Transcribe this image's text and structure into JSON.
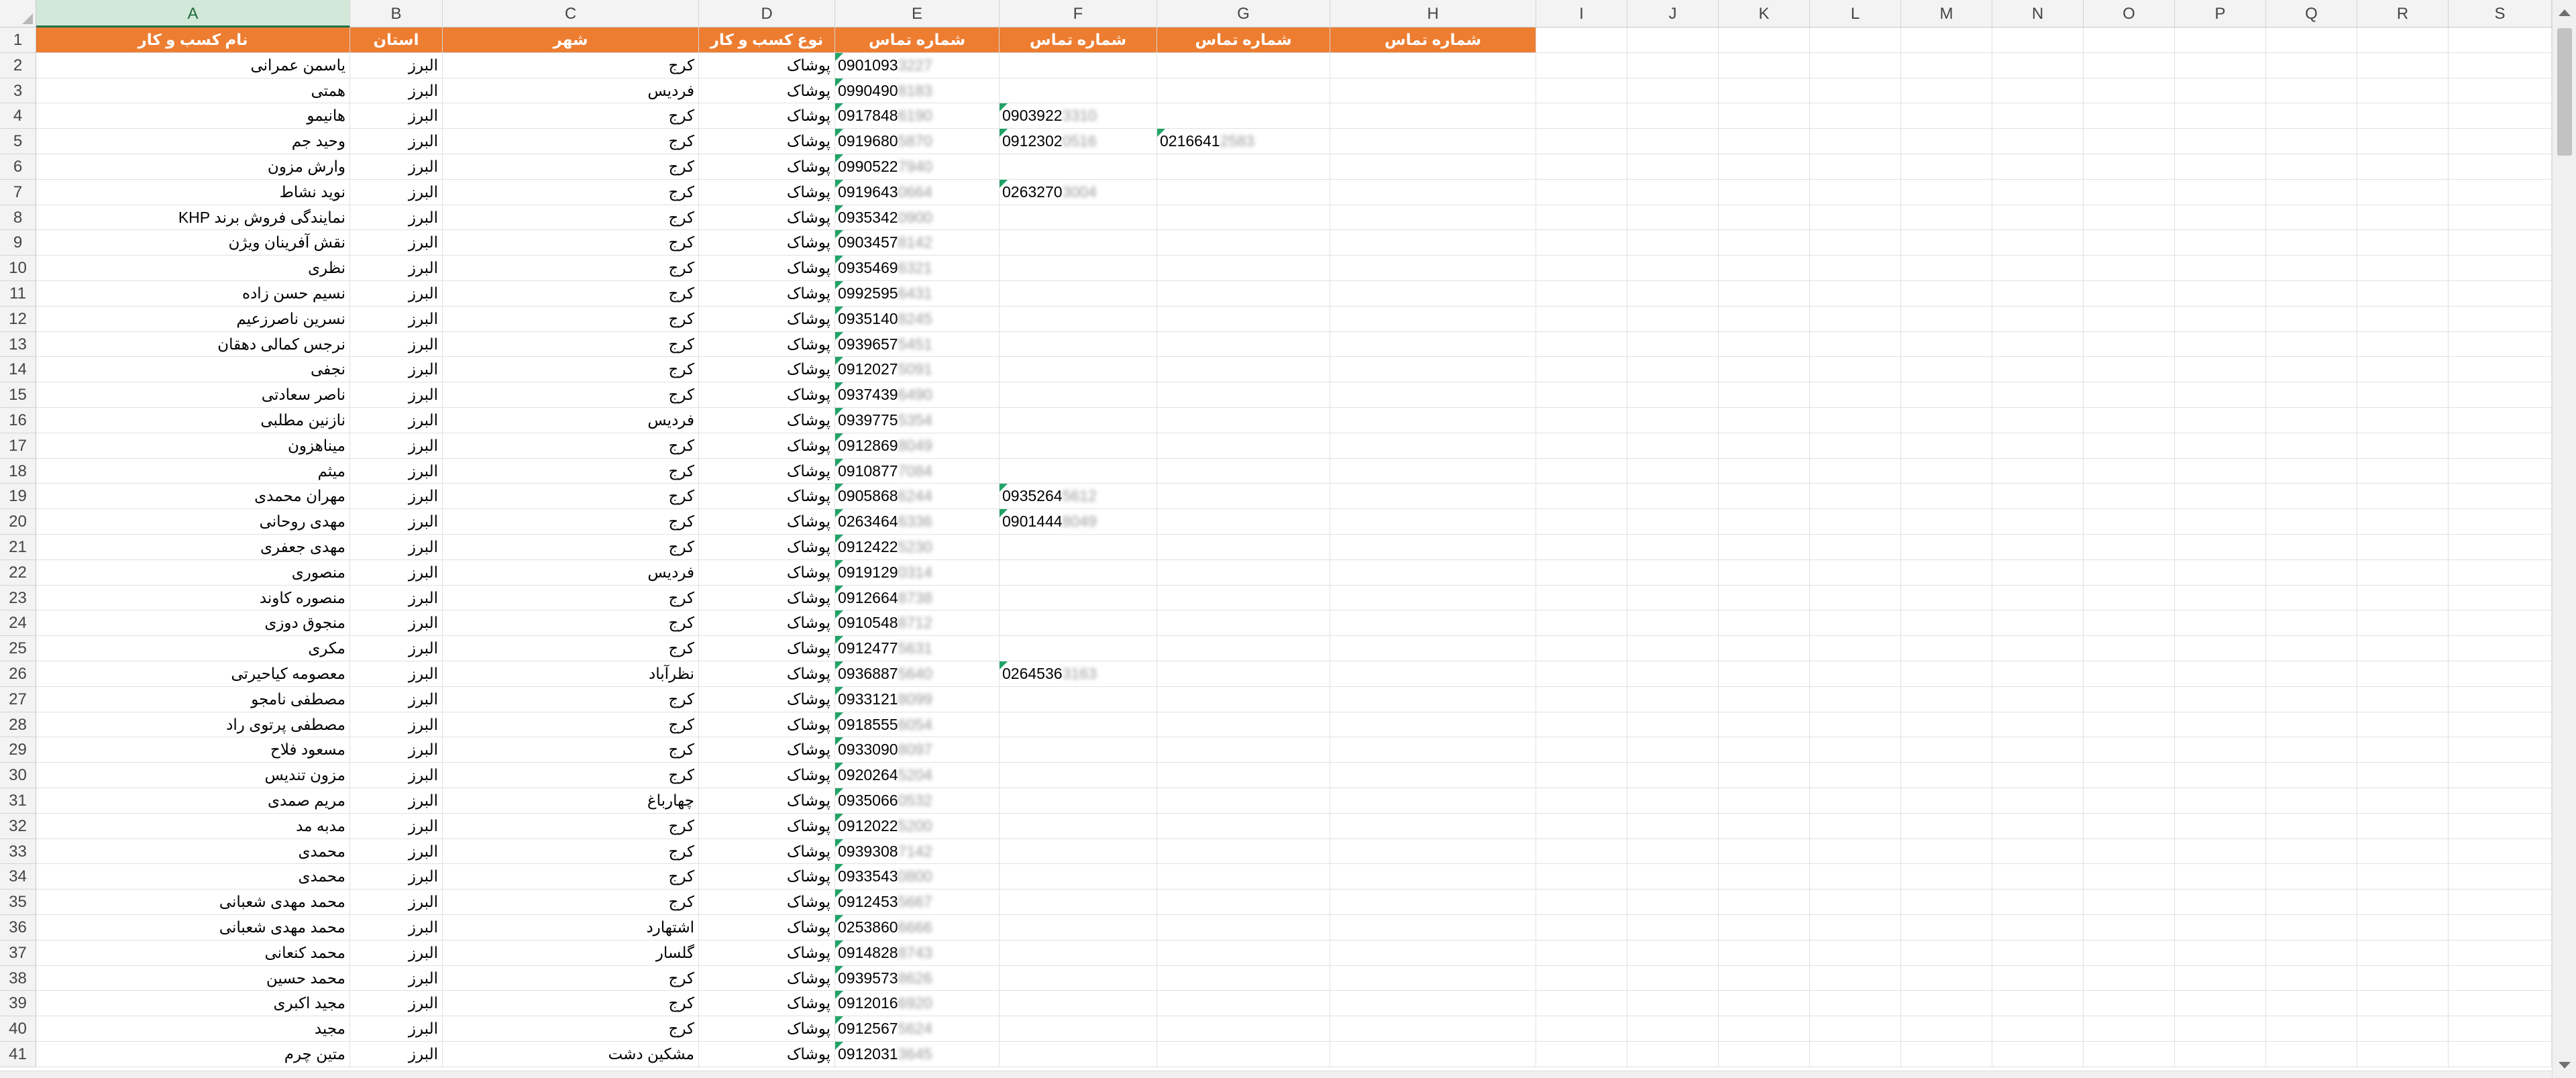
{
  "column_letters": [
    "A",
    "B",
    "C",
    "D",
    "E",
    "F",
    "G",
    "H",
    "I",
    "J",
    "K",
    "L",
    "M",
    "N",
    "O",
    "P",
    "Q",
    "R",
    "S"
  ],
  "selected_column": "A",
  "header_row": {
    "row_number": "1",
    "cells": [
      "نام کسب و کار",
      "استان",
      "شهر",
      "نوع کسب و کار",
      "شماره تماس",
      "شماره تماس",
      "شماره تماس",
      "شماره تماس"
    ]
  },
  "rows": [
    {
      "n": "2",
      "name": "یاسمن عمرانی",
      "prov": "البرز",
      "city": "کرج",
      "type": "پوشاک",
      "phones": [
        [
          "0901093",
          "3227"
        ]
      ]
    },
    {
      "n": "3",
      "name": "همتی",
      "prov": "البرز",
      "city": "فردیس",
      "type": "پوشاک",
      "phones": [
        [
          "0990490",
          "8183"
        ]
      ]
    },
    {
      "n": "4",
      "name": "هانیمو",
      "prov": "البرز",
      "city": "کرج",
      "type": "پوشاک",
      "phones": [
        [
          "0917848",
          "6190"
        ],
        [
          "0903922",
          "3310"
        ]
      ]
    },
    {
      "n": "5",
      "name": "وحید جم",
      "prov": "البرز",
      "city": "کرج",
      "type": "پوشاک",
      "phones": [
        [
          "0919680",
          "5870"
        ],
        [
          "0912302",
          "0516"
        ],
        [
          "0216641",
          "2583"
        ]
      ]
    },
    {
      "n": "6",
      "name": "وارش مزون",
      "prov": "البرز",
      "city": "کرج",
      "type": "پوشاک",
      "phones": [
        [
          "0990522",
          "7940"
        ]
      ]
    },
    {
      "n": "7",
      "name": "نوید نشاط",
      "prov": "البرز",
      "city": "کرج",
      "type": "پوشاک",
      "phones": [
        [
          "0919643",
          "0664"
        ],
        [
          "0263270",
          "3004"
        ]
      ]
    },
    {
      "n": "8",
      "name": "نمایندگی فروش برند KHP",
      "prov": "البرز",
      "city": "کرج",
      "type": "پوشاک",
      "phones": [
        [
          "0935342",
          "0900"
        ]
      ]
    },
    {
      "n": "9",
      "name": "نقش آفرینان ویژن",
      "prov": "البرز",
      "city": "کرج",
      "type": "پوشاک",
      "phones": [
        [
          "0903457",
          "8142"
        ]
      ]
    },
    {
      "n": "10",
      "name": "نظری",
      "prov": "البرز",
      "city": "کرج",
      "type": "پوشاک",
      "phones": [
        [
          "0935469",
          "6321"
        ]
      ]
    },
    {
      "n": "11",
      "name": "نسیم حسن زاده",
      "prov": "البرز",
      "city": "کرج",
      "type": "پوشاک",
      "phones": [
        [
          "0992595",
          "6431"
        ]
      ]
    },
    {
      "n": "12",
      "name": "نسرین ناصرزعیم",
      "prov": "البرز",
      "city": "کرج",
      "type": "پوشاک",
      "phones": [
        [
          "0935140",
          "8245"
        ]
      ]
    },
    {
      "n": "13",
      "name": "نرجس کمالی دهقان",
      "prov": "البرز",
      "city": "کرج",
      "type": "پوشاک",
      "phones": [
        [
          "0939657",
          "5451"
        ]
      ]
    },
    {
      "n": "14",
      "name": "نجفی",
      "prov": "البرز",
      "city": "کرج",
      "type": "پوشاک",
      "phones": [
        [
          "0912027",
          "5091"
        ]
      ]
    },
    {
      "n": "15",
      "name": "ناصر سعادتی",
      "prov": "البرز",
      "city": "کرج",
      "type": "پوشاک",
      "phones": [
        [
          "0937439",
          "6490"
        ]
      ]
    },
    {
      "n": "16",
      "name": "نازنین مطلبی",
      "prov": "البرز",
      "city": "فردیس",
      "type": "پوشاک",
      "phones": [
        [
          "0939775",
          "5354"
        ]
      ]
    },
    {
      "n": "17",
      "name": "میناهزون",
      "prov": "البرز",
      "city": "کرج",
      "type": "پوشاک",
      "phones": [
        [
          "0912869",
          "8049"
        ]
      ]
    },
    {
      "n": "18",
      "name": "میثم",
      "prov": "البرز",
      "city": "کرج",
      "type": "پوشاک",
      "phones": [
        [
          "0910877",
          "7084"
        ]
      ]
    },
    {
      "n": "19",
      "name": "مهران محمدی",
      "prov": "البرز",
      "city": "کرج",
      "type": "پوشاک",
      "phones": [
        [
          "0905868",
          "6244"
        ],
        [
          "0935264",
          "5612"
        ]
      ]
    },
    {
      "n": "20",
      "name": "مهدی روحانی",
      "prov": "البرز",
      "city": "کرج",
      "type": "پوشاک",
      "phones": [
        [
          "0263464",
          "6336"
        ],
        [
          "0901444",
          "8049"
        ]
      ]
    },
    {
      "n": "21",
      "name": "مهدی جعفری",
      "prov": "البرز",
      "city": "کرج",
      "type": "پوشاک",
      "phones": [
        [
          "0912422",
          "5230"
        ]
      ]
    },
    {
      "n": "22",
      "name": "منصوری",
      "prov": "البرز",
      "city": "فردیس",
      "type": "پوشاک",
      "phones": [
        [
          "0919129",
          "0314"
        ]
      ]
    },
    {
      "n": "23",
      "name": "منصوره کاوند",
      "prov": "البرز",
      "city": "کرج",
      "type": "پوشاک",
      "phones": [
        [
          "0912664",
          "8738"
        ]
      ]
    },
    {
      "n": "24",
      "name": "منجوق دوزی",
      "prov": "البرز",
      "city": "کرج",
      "type": "پوشاک",
      "phones": [
        [
          "0910548",
          "8712"
        ]
      ]
    },
    {
      "n": "25",
      "name": "مکری",
      "prov": "البرز",
      "city": "کرج",
      "type": "پوشاک",
      "phones": [
        [
          "0912477",
          "5631"
        ]
      ]
    },
    {
      "n": "26",
      "name": "معصومه کیاحیرتی",
      "prov": "البرز",
      "city": "نظرآباد",
      "type": "پوشاک",
      "phones": [
        [
          "0936887",
          "5640"
        ],
        [
          "0264536",
          "3163"
        ]
      ]
    },
    {
      "n": "27",
      "name": "مصطفی نامجو",
      "prov": "البرز",
      "city": "کرج",
      "type": "پوشاک",
      "phones": [
        [
          "0933121",
          "8099"
        ]
      ]
    },
    {
      "n": "28",
      "name": "مصطفی پرتوی راد",
      "prov": "البرز",
      "city": "کرج",
      "type": "پوشاک",
      "phones": [
        [
          "0918555",
          "6054"
        ]
      ]
    },
    {
      "n": "29",
      "name": "مسعود فلاح",
      "prov": "البرز",
      "city": "کرج",
      "type": "پوشاک",
      "phones": [
        [
          "0933090",
          "8097"
        ]
      ]
    },
    {
      "n": "30",
      "name": "مزون تندیس",
      "prov": "البرز",
      "city": "کرج",
      "type": "پوشاک",
      "phones": [
        [
          "0920264",
          "5204"
        ]
      ]
    },
    {
      "n": "31",
      "name": "مریم صمدی",
      "prov": "البرز",
      "city": "چهارباغ",
      "type": "پوشاک",
      "phones": [
        [
          "0935066",
          "0532"
        ]
      ]
    },
    {
      "n": "32",
      "name": "مدبه مد",
      "prov": "البرز",
      "city": "کرج",
      "type": "پوشاک",
      "phones": [
        [
          "0912022",
          "5200"
        ]
      ]
    },
    {
      "n": "33",
      "name": "محمدی",
      "prov": "البرز",
      "city": "کرج",
      "type": "پوشاک",
      "phones": [
        [
          "0939308",
          "7142"
        ]
      ]
    },
    {
      "n": "34",
      "name": "محمدی",
      "prov": "البرز",
      "city": "کرج",
      "type": "پوشاک",
      "phones": [
        [
          "0933543",
          "0800"
        ]
      ]
    },
    {
      "n": "35",
      "name": "محمد مهدی شعبانی",
      "prov": "البرز",
      "city": "کرج",
      "type": "پوشاک",
      "phones": [
        [
          "0912453",
          "5667"
        ]
      ]
    },
    {
      "n": "36",
      "name": "محمد مهدی شعبانی",
      "prov": "البرز",
      "city": "اشتهارد",
      "type": "پوشاک",
      "phones": [
        [
          "0253860",
          "6666"
        ]
      ]
    },
    {
      "n": "37",
      "name": "محمد کنعانی",
      "prov": "البرز",
      "city": "گلسار",
      "type": "پوشاک",
      "phones": [
        [
          "0914828",
          "8743"
        ]
      ]
    },
    {
      "n": "38",
      "name": "محمد حسین",
      "prov": "البرز",
      "city": "کرج",
      "type": "پوشاک",
      "phones": [
        [
          "0939573",
          "8626"
        ]
      ]
    },
    {
      "n": "39",
      "name": "مجید اکبری",
      "prov": "البرز",
      "city": "کرج",
      "type": "پوشاک",
      "phones": [
        [
          "0912016",
          "6920"
        ]
      ]
    },
    {
      "n": "40",
      "name": "مجید",
      "prov": "البرز",
      "city": "کرج",
      "type": "پوشاک",
      "phones": [
        [
          "0912567",
          "5624"
        ]
      ]
    },
    {
      "n": "41",
      "name": "متین چرم",
      "prov": "البرز",
      "city": "مشکین دشت",
      "type": "پوشاک",
      "phones": [
        [
          "0912031",
          "3645"
        ]
      ]
    }
  ],
  "colors": {
    "header_fill": "#ed7d31",
    "header_text": "#ffffff",
    "selection_green": "#217346",
    "error_triangle": "#21a366"
  }
}
